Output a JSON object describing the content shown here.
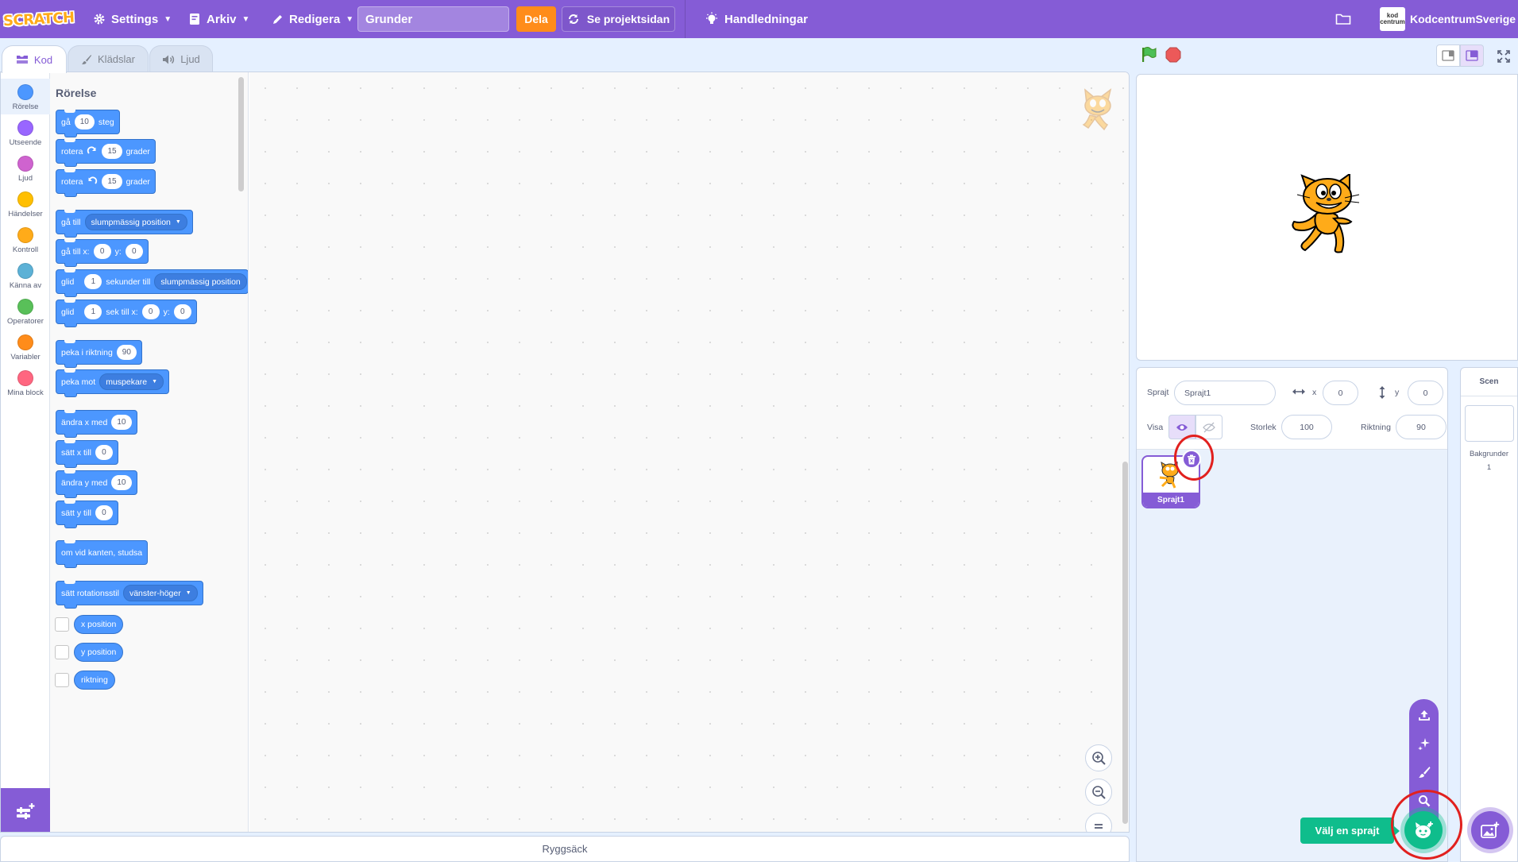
{
  "menubar": {
    "logo_text": "SCRATCH",
    "settings": "Settings",
    "file": "Arkiv",
    "edit": "Redigera",
    "project_title": "Grunder",
    "share": "Dela",
    "project_page": "Se projektsidan",
    "tutorials": "Handledningar",
    "account_avatar_text": "kod centrum",
    "account_name": "KodcentrumSverige"
  },
  "tabs": {
    "code": "Kod",
    "costumes": "Klädslar",
    "sounds": "Ljud"
  },
  "categories": [
    {
      "label": "Rörelse",
      "color": "#4c97ff"
    },
    {
      "label": "Utseende",
      "color": "#9966ff"
    },
    {
      "label": "Ljud",
      "color": "#cf63cf"
    },
    {
      "label": "Händelser",
      "color": "#ffbf00"
    },
    {
      "label": "Kontroll",
      "color": "#ffab19"
    },
    {
      "label": "Känna av",
      "color": "#5cb1d6"
    },
    {
      "label": "Operatorer",
      "color": "#59c059"
    },
    {
      "label": "Variabler",
      "color": "#ff8c1a"
    },
    {
      "label": "Mina block",
      "color": "#ff6680"
    }
  ],
  "palette": {
    "title": "Rörelse",
    "move_a": "gå",
    "move_steps": "10",
    "move_b": "steg",
    "turn_r_a": "rotera",
    "turn_r_deg": "15",
    "turn_r_b": "grader",
    "turn_l_a": "rotera",
    "turn_l_deg": "15",
    "turn_l_b": "grader",
    "goto_a": "gå till",
    "goto_dd": "slumpmässig position",
    "gotoxy_a": "gå till x:",
    "gotoxy_x": "0",
    "gotoxy_yl": "y:",
    "gotoxy_y": "0",
    "glide_a": "glid",
    "glide_secs": "1",
    "glide_b": "sekunder till",
    "glide_dd": "slumpmässig position",
    "glidexy_a": "glid",
    "glidexy_secs": "1",
    "glidexy_b": "sek till x:",
    "glidexy_x": "0",
    "glidexy_yl": "y:",
    "glidexy_y": "0",
    "point_a": "peka i riktning",
    "point_val": "90",
    "pointto_a": "peka mot",
    "pointto_dd": "muspekare",
    "changex_a": "ändra x med",
    "changex_val": "10",
    "setx_a": "sätt x till",
    "setx_val": "0",
    "changey_a": "ändra y med",
    "changey_val": "10",
    "sety_a": "sätt y till",
    "sety_val": "0",
    "bounce": "om vid kanten, studsa",
    "rotstyle_a": "sätt rotationsstil",
    "rotstyle_dd": "vänster-höger",
    "rep_x": "x position",
    "rep_y": "y position",
    "rep_dir": "riktning"
  },
  "backpack": "Ryggsäck",
  "sprite_info": {
    "sprite_label": "Sprajt",
    "sprite_name": "Sprajt1",
    "x_label": "x",
    "x_value": "0",
    "y_label": "y",
    "y_value": "0",
    "show_label": "Visa",
    "size_label": "Storlek",
    "size_value": "100",
    "direction_label": "Riktning",
    "direction_value": "90"
  },
  "sprites": [
    {
      "name": "Sprajt1"
    }
  ],
  "stage_pane": {
    "title": "Scen",
    "backdrops_label": "Bakgrunder",
    "backdrops_count": "1"
  },
  "add_sprite_tooltip": "Välj en sprajt",
  "colors": {
    "accent": "#855cd6",
    "motion": "#4c97ff",
    "share": "#ff8c1a",
    "green": "#0fbd8c",
    "highlight": "#e1201e"
  }
}
